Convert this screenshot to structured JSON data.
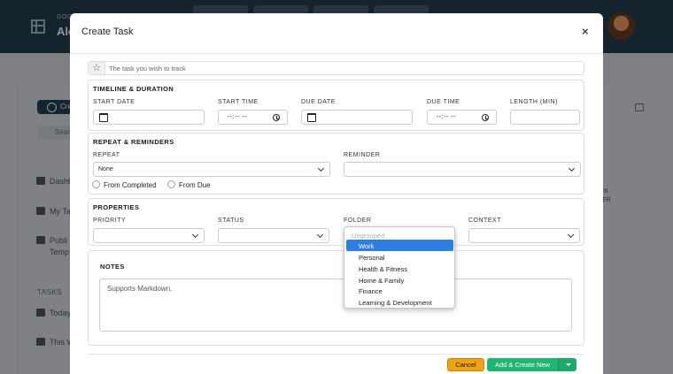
{
  "background": {
    "greeting": "GOO",
    "user_name": "Ale",
    "create_label": "Cre",
    "search_label": "Sear",
    "nav": [
      "Dashb",
      "My Ta",
      "Publi",
      "Temp"
    ],
    "tasks_heading": "TASKS",
    "tasks_nav": [
      "Today",
      "This W"
    ],
    "right_text": [
      "m",
      "ER"
    ]
  },
  "modal": {
    "title": "Create Task",
    "close_glyph": "×",
    "task_placeholder": "The task you wish to track",
    "star_glyph": "☆",
    "timeline": {
      "heading": "TIMELINE & DURATION",
      "labels": {
        "start_date": "START DATE",
        "start_time": "START TIME",
        "due_date": "DUE DATE",
        "due_time": "DUE TIME",
        "length": "LENGTH (MIN)"
      },
      "time_placeholder": "--:-- --"
    },
    "repeat": {
      "heading": "REPEAT & REMINDERS",
      "repeat_label": "REPEAT",
      "repeat_value": "None",
      "reminder_label": "REMINDER",
      "radio_from_completed": "From Completed",
      "radio_from_due": "From Due"
    },
    "properties": {
      "heading": "PROPERTIES",
      "priority_label": "PRIORITY",
      "status_label": "STATUS",
      "folder_label": "FOLDER",
      "context_label": "CONTEXT"
    },
    "folder_dropdown": {
      "placeholder": "Ungrouped",
      "options": [
        "Work",
        "Personal",
        "Health & Fitness",
        "Home & Family",
        "Finance",
        "Learning & Development"
      ],
      "highlighted": "Work"
    },
    "notes": {
      "heading": "NOTES",
      "placeholder": "Supports Markdown."
    },
    "buttons": {
      "cancel": "Cancel",
      "add_create": "Add & Create New"
    }
  },
  "colors": {
    "cancel": "#f0a215",
    "primary": "#21b573",
    "highlight": "#2f7fe0",
    "header_bg": "#14232c"
  }
}
